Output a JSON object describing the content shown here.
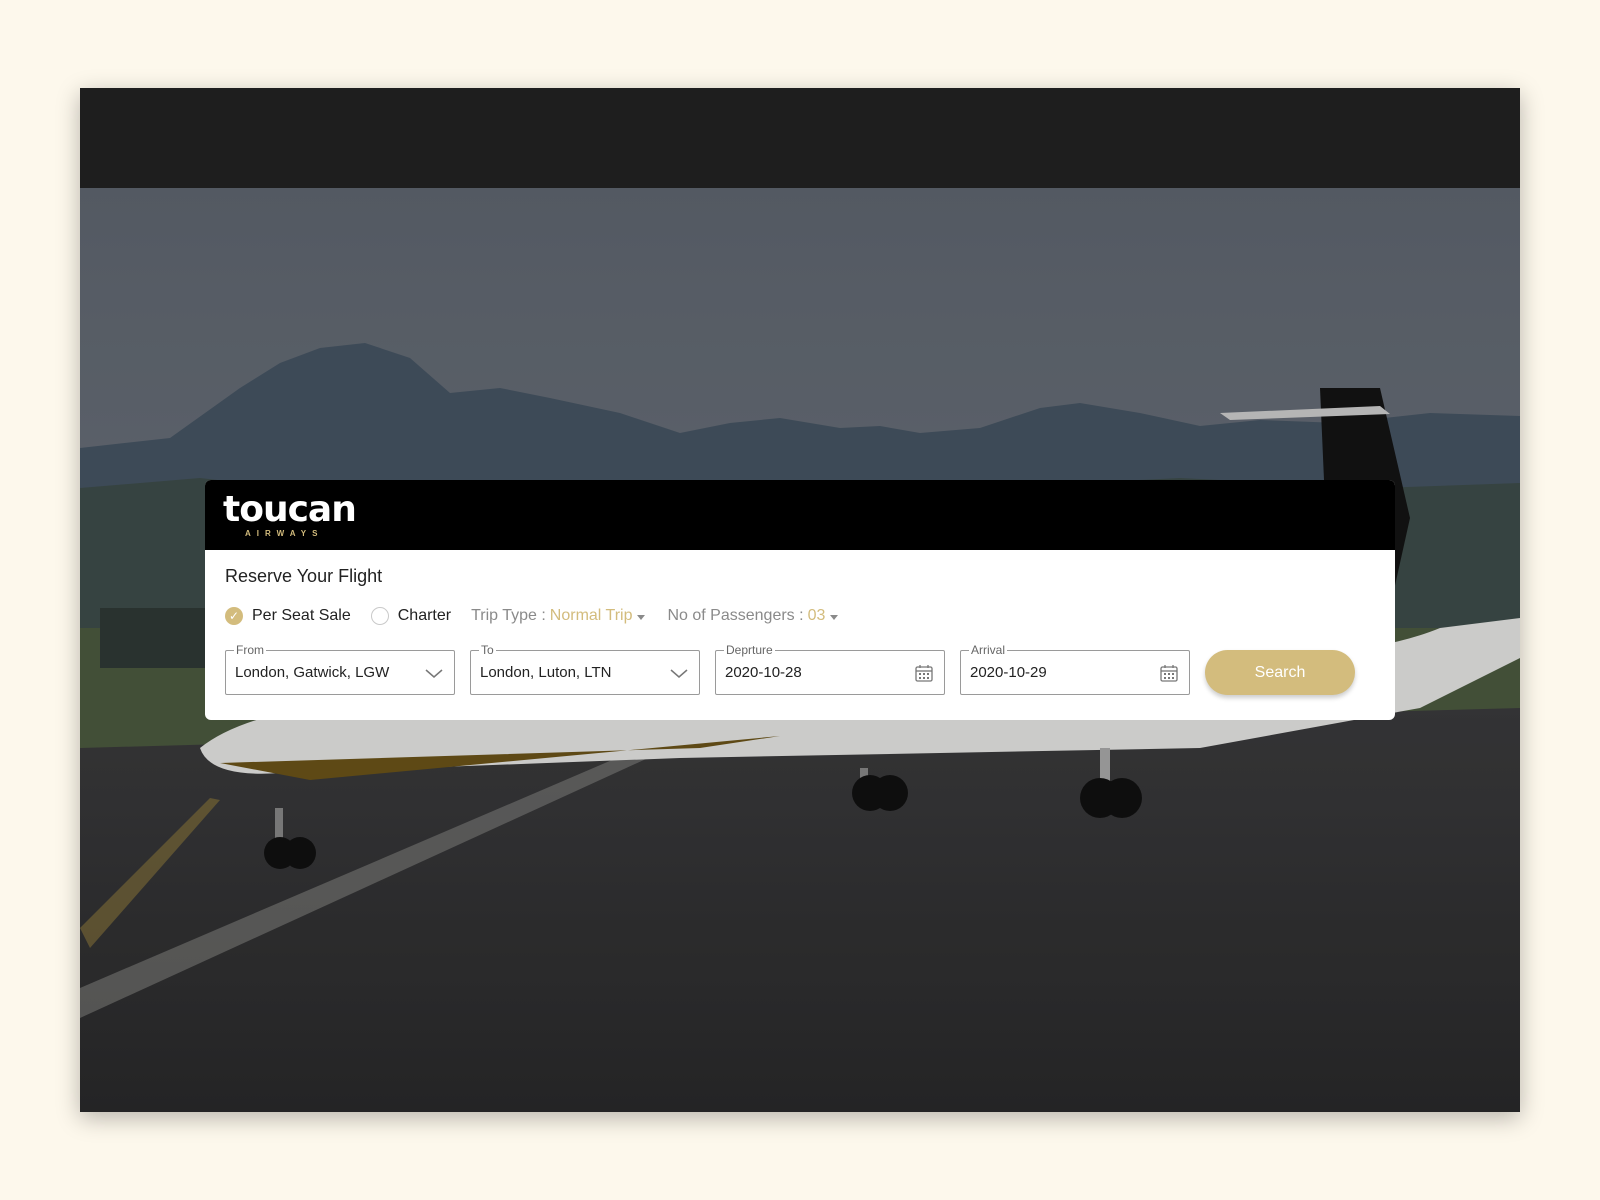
{
  "brand": {
    "name": "toucan",
    "tagline": "AIRWAYS",
    "accent_color": "#d3bc7d"
  },
  "booking": {
    "heading": "Reserve Your Flight",
    "sale_options": [
      {
        "label": "Per Seat Sale",
        "selected": true
      },
      {
        "label": "Charter",
        "selected": false
      }
    ],
    "trip_type": {
      "label": "Trip Type :",
      "value": "Normal Trip"
    },
    "passengers": {
      "label": "No of Passengers :",
      "value": "03"
    },
    "fields": {
      "from": {
        "legend": "From",
        "value": "London, Gatwick, LGW",
        "icon": "chevron-down-icon"
      },
      "to": {
        "legend": "To",
        "value": "London, Luton, LTN",
        "icon": "chevron-down-icon"
      },
      "departure": {
        "legend": "Deprture",
        "value": "2020-10-28",
        "icon": "calendar-icon"
      },
      "arrival": {
        "legend": "Arrival",
        "value": "2020-10-29",
        "icon": "calendar-icon"
      }
    },
    "search_label": "Search"
  }
}
